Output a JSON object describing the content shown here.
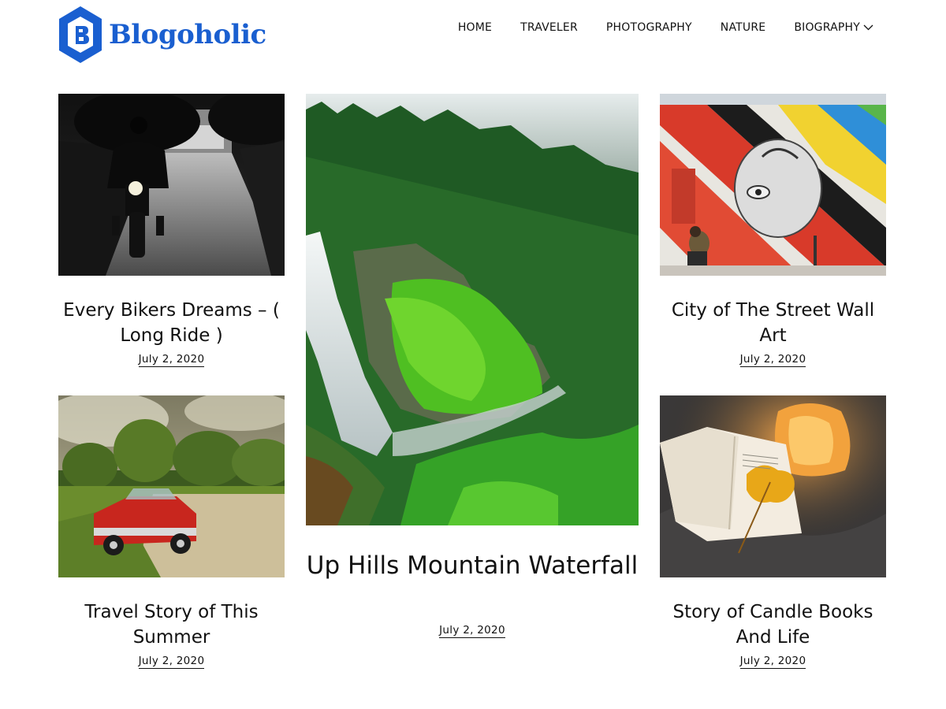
{
  "site": {
    "name": "Blogoholic",
    "brand_color": "#1a5fd0"
  },
  "nav": {
    "items": [
      {
        "label": "HOME"
      },
      {
        "label": "TRAVELER"
      },
      {
        "label": "PHOTOGRAPHY"
      },
      {
        "label": "NATURE"
      },
      {
        "label": "BIOGRAPHY",
        "has_dropdown": true
      }
    ]
  },
  "posts": [
    {
      "title": "Every Bikers Dreams – ( Long Ride )",
      "date": "July 2, 2020",
      "image": "motorcycle-on-road-photo"
    },
    {
      "title": "Up Hills Mountain Waterfall",
      "date": "July 2, 2020",
      "image": "forest-waterfall-photo"
    },
    {
      "title": "City of The Street Wall Art",
      "date": "July 2, 2020",
      "image": "street-wall-art-photo"
    },
    {
      "title": "Travel Story of This Summer",
      "date": "July 2, 2020",
      "image": "red-vintage-car-photo"
    },
    {
      "title": "Story of Candle Books And Life",
      "date": "July 2, 2020",
      "image": "book-candle-leaf-photo"
    }
  ]
}
